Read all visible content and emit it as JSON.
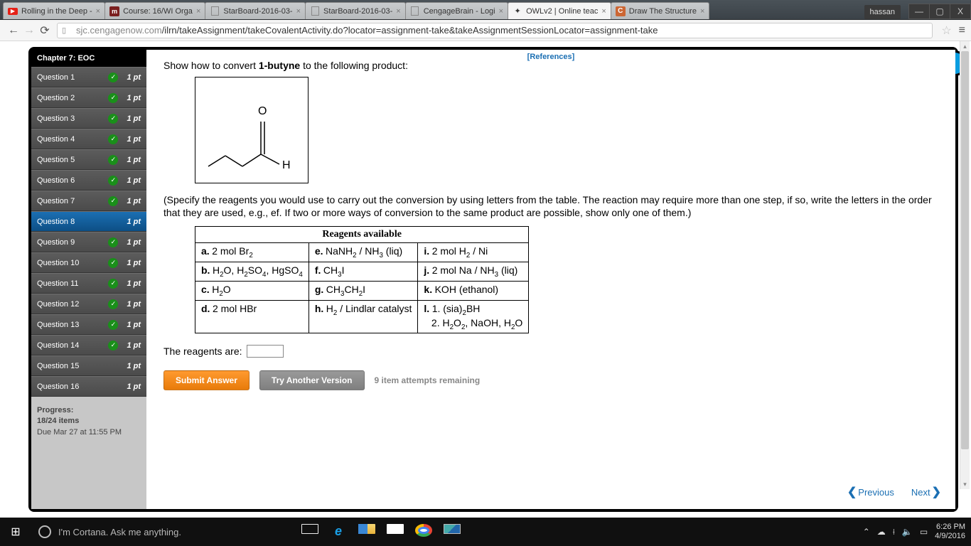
{
  "window": {
    "profile": "hassan",
    "min": "—",
    "max": "▢",
    "close": "X"
  },
  "tabs": [
    {
      "title": "Rolling in the Deep -",
      "favicon": "yt"
    },
    {
      "title": "Course: 16/WI Orga",
      "favicon": "m"
    },
    {
      "title": "StarBoard-2016-03-",
      "favicon": "doc"
    },
    {
      "title": "StarBoard-2016-03-",
      "favicon": "doc"
    },
    {
      "title": "CengageBrain - Logi",
      "favicon": "doc"
    },
    {
      "title": "OWLv2 | Online teac",
      "favicon": "owl",
      "active": true
    },
    {
      "title": "Draw The Structure",
      "favicon": "c"
    }
  ],
  "url": {
    "host": "sjc.cengagenow.com",
    "path": "/ilrn/takeAssignment/takeCovalentActivity.do?locator=assignment-take&takeAssignmentSessionLocator=assignment-take"
  },
  "chapter_header": "Chapter 7: EOC",
  "questions": [
    {
      "label": "Question 1",
      "pts": "1 pt",
      "done": true
    },
    {
      "label": "Question 2",
      "pts": "1 pt",
      "done": true
    },
    {
      "label": "Question 3",
      "pts": "1 pt",
      "done": true
    },
    {
      "label": "Question 4",
      "pts": "1 pt",
      "done": true
    },
    {
      "label": "Question 5",
      "pts": "1 pt",
      "done": true
    },
    {
      "label": "Question 6",
      "pts": "1 pt",
      "done": true
    },
    {
      "label": "Question 7",
      "pts": "1 pt",
      "done": true
    },
    {
      "label": "Question 8",
      "pts": "1 pt",
      "done": false,
      "active": true
    },
    {
      "label": "Question 9",
      "pts": "1 pt",
      "done": true
    },
    {
      "label": "Question 10",
      "pts": "1 pt",
      "done": true
    },
    {
      "label": "Question 11",
      "pts": "1 pt",
      "done": true
    },
    {
      "label": "Question 12",
      "pts": "1 pt",
      "done": true
    },
    {
      "label": "Question 13",
      "pts": "1 pt",
      "done": true
    },
    {
      "label": "Question 14",
      "pts": "1 pt",
      "done": true
    },
    {
      "label": "Question 15",
      "pts": "1 pt",
      "done": false
    },
    {
      "label": "Question 16",
      "pts": "1 pt",
      "done": false
    }
  ],
  "progress": {
    "label": "Progress:",
    "count": "18/24 items",
    "due": "Due Mar 27 at 11:55 PM"
  },
  "references": "[References]",
  "prompt_prefix": "Show how to convert ",
  "prompt_bold": "1-butyne",
  "prompt_suffix": " to the following product:",
  "mol": {
    "O": "O",
    "H": "H"
  },
  "instructions": "(Specify the reagents you would use to carry out the conversion by using letters from the table. The reaction may require more than one step, if so, write the letters in the order that they are used, e.g., ef. If two or more ways of conversion to the same product are possible, show only one of them.)",
  "table_header": "Reagents available",
  "reagents": {
    "a": {
      "l": "a.",
      "t": "2 mol Br",
      "s": "2"
    },
    "b": {
      "l": "b.",
      "t1": "H",
      "s1": "2",
      "t2": "O, H",
      "s2": "2",
      "t3": "SO",
      "s3": "4",
      "t4": ", HgSO",
      "s4": "4"
    },
    "c": {
      "l": "c.",
      "t": "H",
      "s": "2",
      "t2": "O"
    },
    "d": {
      "l": "d.",
      "t": "2 mol HBr"
    },
    "e": {
      "l": "e.",
      "t1": "NaNH",
      "s1": "2",
      "t2": " / NH",
      "s2": "3",
      "t3": " (liq)"
    },
    "f": {
      "l": "f.",
      "t1": "CH",
      "s1": "3",
      "t2": "I"
    },
    "g": {
      "l": "g.",
      "t1": "CH",
      "s1": "3",
      "t2": "CH",
      "s2": "2",
      "t3": "I"
    },
    "h": {
      "l": "h.",
      "t1": "H",
      "s1": "2",
      "t2": " / Lindlar catalyst"
    },
    "i": {
      "l": "i.",
      "t1": "2 mol H",
      "s1": "2",
      "t2": " / Ni"
    },
    "j": {
      "l": "j.",
      "t1": "2 mol Na / NH",
      "s1": "3",
      "t2": " (liq)"
    },
    "k": {
      "l": "k.",
      "t": "KOH (ethanol)"
    },
    "l": {
      "l": "l.",
      "ln1a": "1. (sia)",
      "ln1s": "2",
      "ln1b": "BH",
      "ln2a": "2. H",
      "ln2s1": "2",
      "ln2b": "O",
      "ln2s2": "2",
      "ln2c": ", NaOH, H",
      "ln2s3": "2",
      "ln2d": "O"
    }
  },
  "answer_label": "The reagents are:",
  "buttons": {
    "submit": "Submit Answer",
    "another": "Try Another Version"
  },
  "attempts": "9 item attempts remaining",
  "pager": {
    "prev": "Previous",
    "next": "Next"
  },
  "taskbar": {
    "cortana": "I'm Cortana. Ask me anything.",
    "time": "6:26 PM",
    "date": "4/9/2016",
    "tray": {
      "up": "⌃",
      "cloud": "☁",
      "wifi": "⟊",
      "vol": "🔈",
      "note": "▭"
    }
  }
}
